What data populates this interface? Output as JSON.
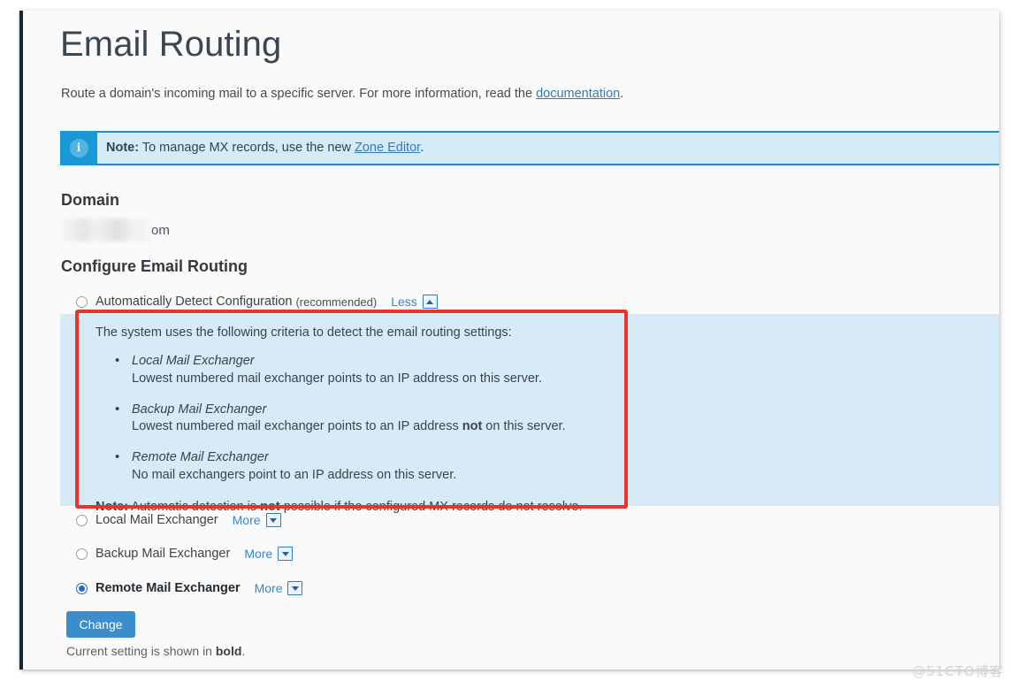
{
  "page": {
    "title": "Email Routing",
    "intro_before": "Route a domain's incoming mail to a specific server. For more information, read the ",
    "intro_link": "documentation",
    "intro_after": "."
  },
  "alert": {
    "icon": "info-icon",
    "icon_glyph": "i",
    "label": "Note:",
    "text_before": " To manage MX records, use the new ",
    "link": "Zone Editor",
    "text_after": ".",
    "background_color": "#d4ebf9",
    "border_color": "#1b8fd1",
    "icon_background": "#1899d6"
  },
  "domain_section": {
    "heading": "Domain",
    "value_redacted": true,
    "value_suffix": "om"
  },
  "configure_section": {
    "heading": "Configure Email Routing",
    "options": [
      {
        "id": "auto",
        "label": "Automatically Detect Configuration",
        "sublabel": "(recommended)",
        "selected": false,
        "bold": false,
        "toggle_label": "Less",
        "toggle_icon": "chevron-up-icon"
      },
      {
        "id": "local",
        "label": "Local Mail Exchanger",
        "sublabel": "",
        "selected": false,
        "bold": false,
        "toggle_label": "More",
        "toggle_icon": "chevron-down-icon"
      },
      {
        "id": "backup",
        "label": "Backup Mail Exchanger",
        "sublabel": "",
        "selected": false,
        "bold": false,
        "toggle_label": "More",
        "toggle_icon": "chevron-down-icon"
      },
      {
        "id": "remote",
        "label": "Remote Mail Exchanger",
        "sublabel": "",
        "selected": true,
        "bold": true,
        "toggle_label": "More",
        "toggle_icon": "chevron-down-icon"
      }
    ]
  },
  "criteria_panel": {
    "highlighted": true,
    "highlight_color": "#e8342a",
    "background_color": "#d6eaf8",
    "lead": "The system uses the following criteria to detect the email routing settings:",
    "items": [
      {
        "title": "Local Mail Exchanger",
        "desc_before": "Lowest numbered mail exchanger points to an IP address on this server.",
        "desc_bold": "",
        "desc_after": ""
      },
      {
        "title": "Backup Mail Exchanger",
        "desc_before": "Lowest numbered mail exchanger points to an IP address ",
        "desc_bold": "not",
        "desc_after": " on this server."
      },
      {
        "title": "Remote Mail Exchanger",
        "desc_before": "No mail exchangers point to an IP address on this server.",
        "desc_bold": "",
        "desc_after": ""
      }
    ],
    "note_label": "Note:",
    "note_before": " Automatic detection is ",
    "note_bold": "not",
    "note_after": " possible if the configured MX records do not resolve."
  },
  "actions": {
    "change_label": "Change",
    "change_color": "#3c8dcb",
    "footnote_before": "Current setting is shown in ",
    "footnote_bold": "bold",
    "footnote_after": "."
  },
  "watermark": {
    "text": "@51CTO博客"
  }
}
